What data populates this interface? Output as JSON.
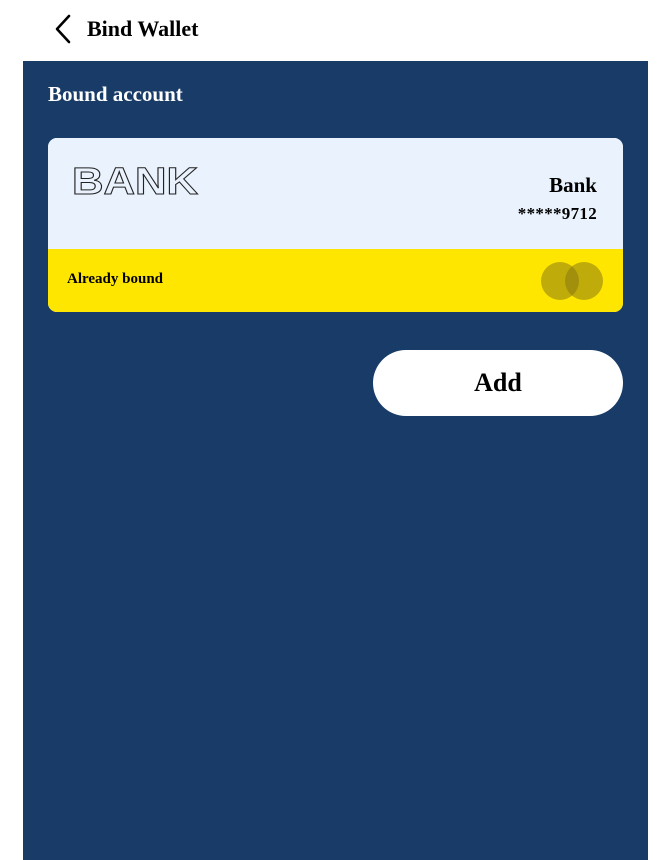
{
  "header": {
    "title": "Bind Wallet",
    "back_icon": "chevron-left-icon"
  },
  "section": {
    "title": "Bound account"
  },
  "card": {
    "logo_text": "BANK",
    "bank_name": "Bank",
    "account_number": "*****9712",
    "status": "Already bound",
    "card_color": "#eaf3fd",
    "status_color": "#ffe600",
    "brand_icon": "overlapping-circles-icon"
  },
  "actions": {
    "add_label": "Add"
  },
  "colors": {
    "background": "#183c67",
    "header": "#ffffff"
  }
}
